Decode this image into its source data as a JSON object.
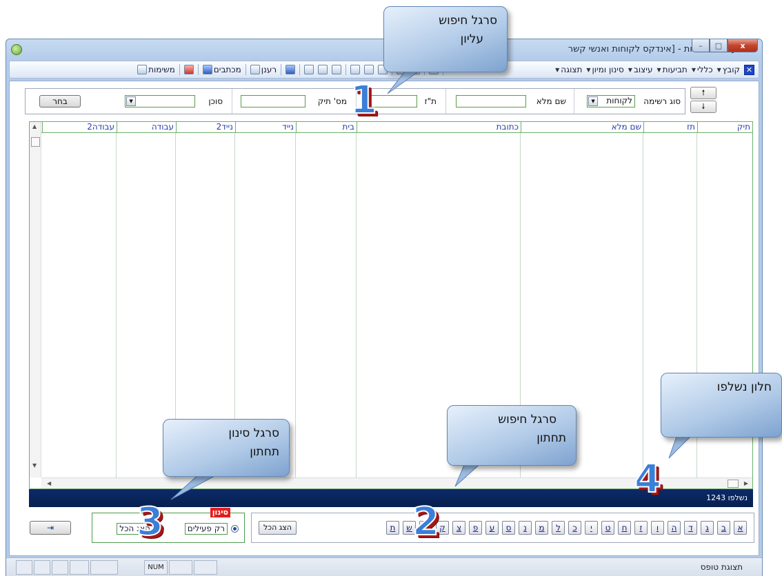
{
  "window": {
    "title": "[אלוני תוכנות - [אינדקס לקוחות ואנשי קשר",
    "controls": [
      "minimize-icon",
      "maximize-icon",
      "close-icon"
    ]
  },
  "toolbar": {
    "menus": [
      "קובץ",
      "כללי",
      "תביעות",
      "עיצוב",
      "סינון ומיון",
      "תצוגה"
    ],
    "reports_label": "רענן",
    "letters_label": "מכתבים",
    "tasks_label": "משימות"
  },
  "search": {
    "list_type_label": "סוג רשימה",
    "list_type_value": "לקוחות",
    "fullname_label": "שם מלא",
    "id_label": "ת\"ז",
    "file_label": "מס' תיק",
    "agent_label": "סוכן",
    "choose_label": "בחר",
    "nav_up_icon": "arrow-up-icon",
    "nav_down_icon": "arrow-down-icon"
  },
  "grid": {
    "columns": [
      "תיק",
      "תז",
      "שם מלא",
      "כתובת",
      "בית",
      "נייד",
      "נייד2",
      "עבודה",
      "עבודה2"
    ]
  },
  "status": {
    "count_label": "נשלפו",
    "count_value": "1243"
  },
  "filter": {
    "title": "סינון",
    "option_active": "רק פעילים",
    "option_all": "הצג הכל",
    "selected": "רק פעילים"
  },
  "alphabet": {
    "letters": [
      "א",
      "ב",
      "ג",
      "ד",
      "ה",
      "ו",
      "ז",
      "ח",
      "ט",
      "י",
      "כ",
      "ל",
      "מ",
      "נ",
      "ס",
      "ע",
      "פ",
      "צ",
      "ק",
      "ר",
      "ש",
      "ת"
    ],
    "show_all_label": "הצג הכל"
  },
  "statusbar": {
    "mode_label": "תצוגת טופס",
    "num_indicator": "NUM"
  },
  "callouts": {
    "c1": {
      "line1": "סרגל חיפוש",
      "line2": "עליון",
      "number": "1"
    },
    "c2": {
      "line1": "סרגל חיפוש",
      "line2": "תחתון",
      "number": "2"
    },
    "c3": {
      "line1": "סרגל סינון",
      "line2": "תחתון",
      "number": "3"
    },
    "c4": {
      "line1": "חלון נשלפו",
      "number": "4"
    }
  },
  "colors": {
    "accent_dark": "#062050",
    "header_text": "#2a3aa8",
    "grid_border": "#6ab06a",
    "filter_badge": "#e51c1c"
  }
}
